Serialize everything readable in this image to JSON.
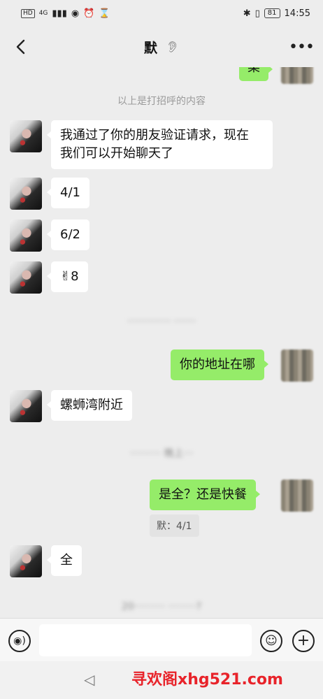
{
  "status_bar": {
    "left_chip": "HD",
    "network": "4G",
    "battery": "81",
    "time": "14:55"
  },
  "header": {
    "title": "默",
    "back_icon": "chevron-left-icon",
    "ear_icon": "ear-icon",
    "more_icon": "more-dots-icon"
  },
  "chat": {
    "partial_top_message": "菜",
    "greeting_divider": "以上是打招呼的内容",
    "messages_her_1": "我通过了你的朋友验证请求，现在",
    "messages_her_1b": "我们可以开始聊天了",
    "msg_4_1": "4/1",
    "msg_6_2": "6/2",
    "msg_8": "✌8",
    "blurred_time_1": "··············  ·······",
    "msg_me_address": "你的地址在哪",
    "msg_her_location": "螺蛳湾附近",
    "blurred_time_2": "··········  晚上···",
    "msg_me_question": "是全？还是快餐",
    "quote_text": "默：4/1",
    "msg_her_full": "全",
    "blurred_time_3": "20··········  ·········?"
  },
  "input_bar": {
    "voice_icon": "voice-icon",
    "emoji_icon": "emoji-icon",
    "plus_icon": "plus-icon"
  },
  "nav_bar": {
    "back_icon": "nav-back-icon"
  },
  "watermark": "寻欢阁xhg521.com",
  "colors": {
    "background": "#ededed",
    "bubble_out": "#95ec69",
    "bubble_in": "#ffffff",
    "watermark": "#e8232a"
  }
}
